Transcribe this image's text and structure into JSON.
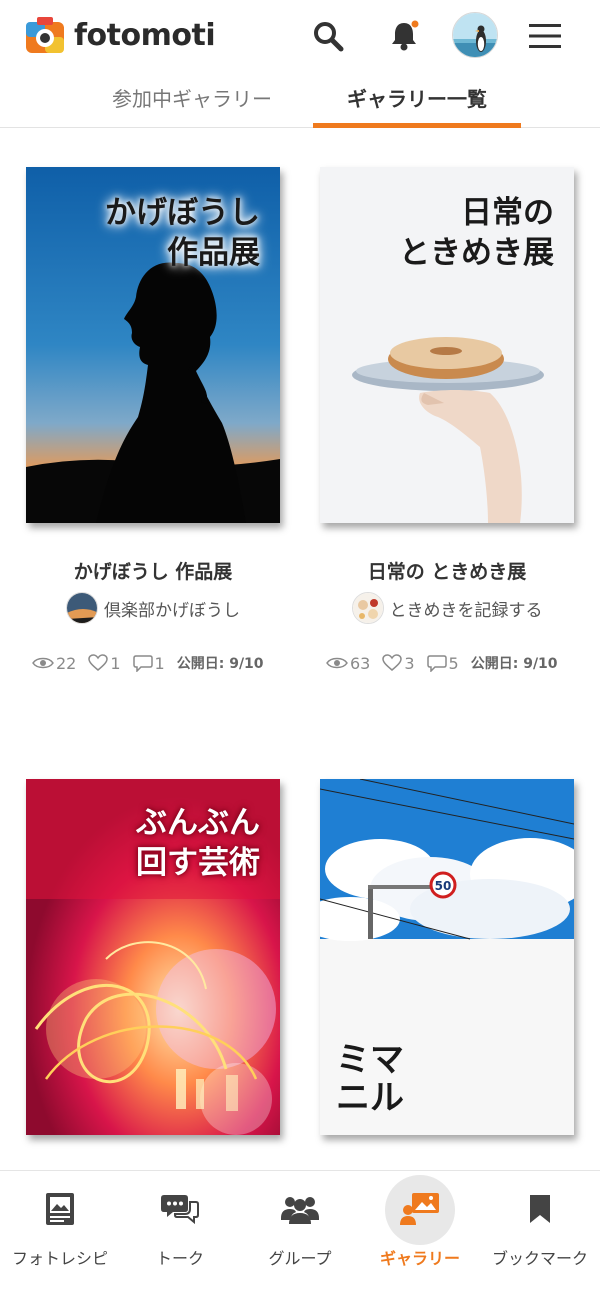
{
  "header": {
    "logo_text": "fotomoti",
    "has_notification_dot": true
  },
  "tabs": [
    {
      "label": "参加中ギャラリー",
      "active": false
    },
    {
      "label": "ギャラリー一覧",
      "active": true
    }
  ],
  "galleries": [
    {
      "cover_title": "かげぼうし\n作品展",
      "title": "かげぼうし 作品展",
      "owner": "倶楽部かげぼうし",
      "views": "22",
      "likes": "1",
      "comments": "1",
      "published": "公開日: 9/10"
    },
    {
      "cover_title": "日常の\nときめき展",
      "title": "日常の ときめき展",
      "owner": "ときめきを記録する",
      "views": "63",
      "likes": "3",
      "comments": "5",
      "published": "公開日: 9/10"
    },
    {
      "cover_title": "ぶんぶん\n回す芸術"
    },
    {
      "cover_title": "ミマ\nニル",
      "sign_number": "50"
    }
  ],
  "bottom_nav": [
    {
      "label": "フォトレシピ",
      "icon": "photo-recipe-icon",
      "active": false
    },
    {
      "label": "トーク",
      "icon": "talk-icon",
      "active": false
    },
    {
      "label": "グループ",
      "icon": "group-icon",
      "active": false
    },
    {
      "label": "ギャラリー",
      "icon": "gallery-icon",
      "active": true
    },
    {
      "label": "ブックマーク",
      "icon": "bookmark-icon",
      "active": false
    }
  ],
  "colors": {
    "accent": "#ef7a1e",
    "text": "#333333",
    "muted": "#8a8a8a"
  }
}
